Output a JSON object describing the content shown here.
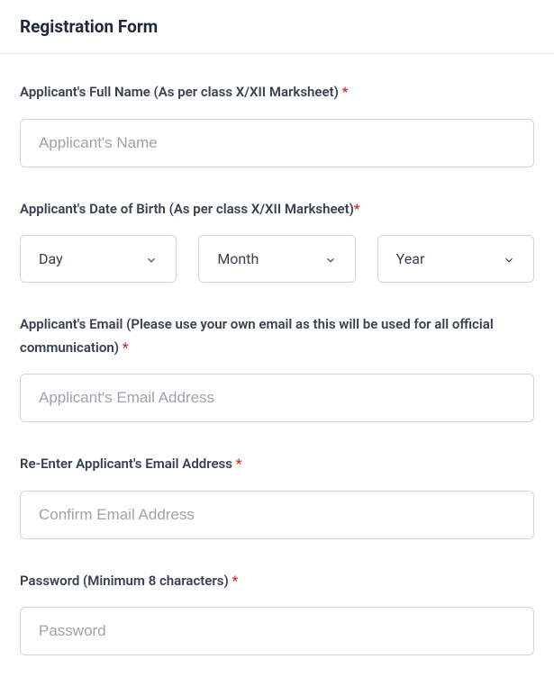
{
  "header": {
    "title": "Registration Form"
  },
  "form": {
    "fullName": {
      "label": "Applicant's Full Name (As per class X/XII Marksheet) ",
      "required": "*",
      "placeholder": "Applicant's Name"
    },
    "dob": {
      "label": "Applicant's Date of Birth (As per class X/XII Marksheet)",
      "required": "*",
      "day": "Day",
      "month": "Month",
      "year": "Year"
    },
    "email": {
      "label": "Applicant's Email (Please use your own email as this will be used for all official communication) ",
      "required": "*",
      "placeholder": "Applicant's Email Address"
    },
    "confirmEmail": {
      "label": "Re-Enter Applicant's Email Address ",
      "required": "*",
      "placeholder": "Confirm Email Address"
    },
    "password": {
      "label": "Password (Minimum 8 characters) ",
      "required": "*",
      "placeholder": "Password"
    }
  }
}
